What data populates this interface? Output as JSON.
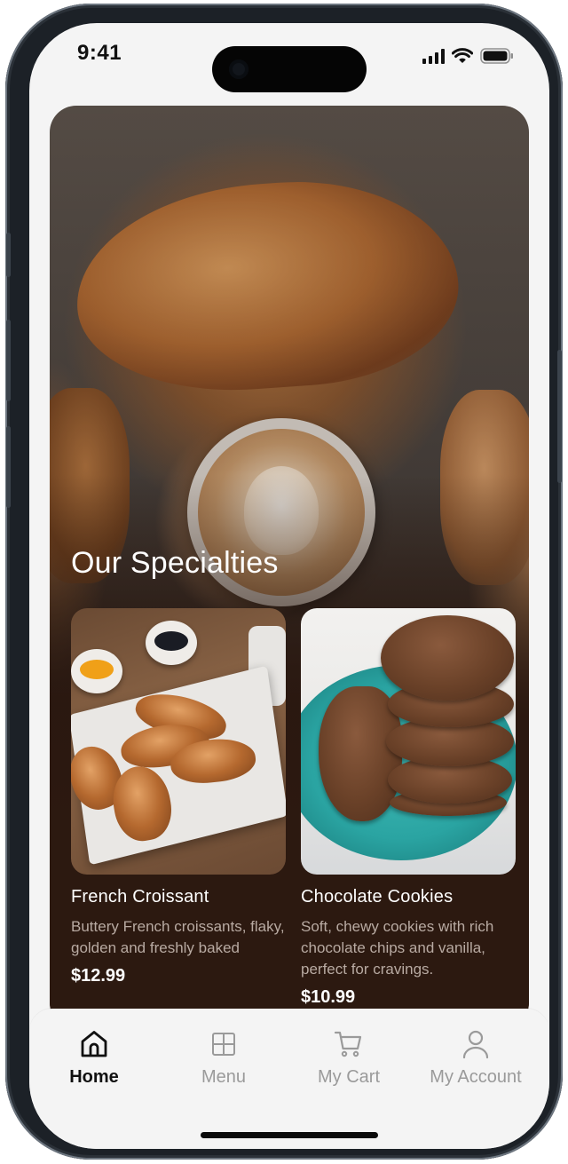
{
  "status_bar": {
    "time": "9:41",
    "icons": [
      "signal-icon",
      "wifi-icon",
      "battery-icon"
    ]
  },
  "hero": {
    "section_title": "Our Specialties"
  },
  "products": [
    {
      "name": "French Croissant",
      "description": "Buttery French croissants, flaky, golden and freshly baked",
      "price": "$12.99",
      "image_icon": "croissant-photo"
    },
    {
      "name": "Chocolate Cookies",
      "description": "Soft, chewy cookies with rich chocolate chips and vanilla, perfect for cravings.",
      "price": "$10.99",
      "image_icon": "cookies-photo"
    }
  ],
  "tab_bar": {
    "active": "Home",
    "items": [
      {
        "label": "Home",
        "icon": "home-icon"
      },
      {
        "label": "Menu",
        "icon": "grid-icon"
      },
      {
        "label": "My Cart",
        "icon": "cart-icon"
      },
      {
        "label": "My Account",
        "icon": "user-icon"
      }
    ]
  },
  "colors": {
    "card_background": "#2c1910",
    "screen_background": "#f4f4f4",
    "active_tab": "#111111",
    "inactive_tab": "#9a9a9a",
    "description_text": "#b8aaa2"
  }
}
